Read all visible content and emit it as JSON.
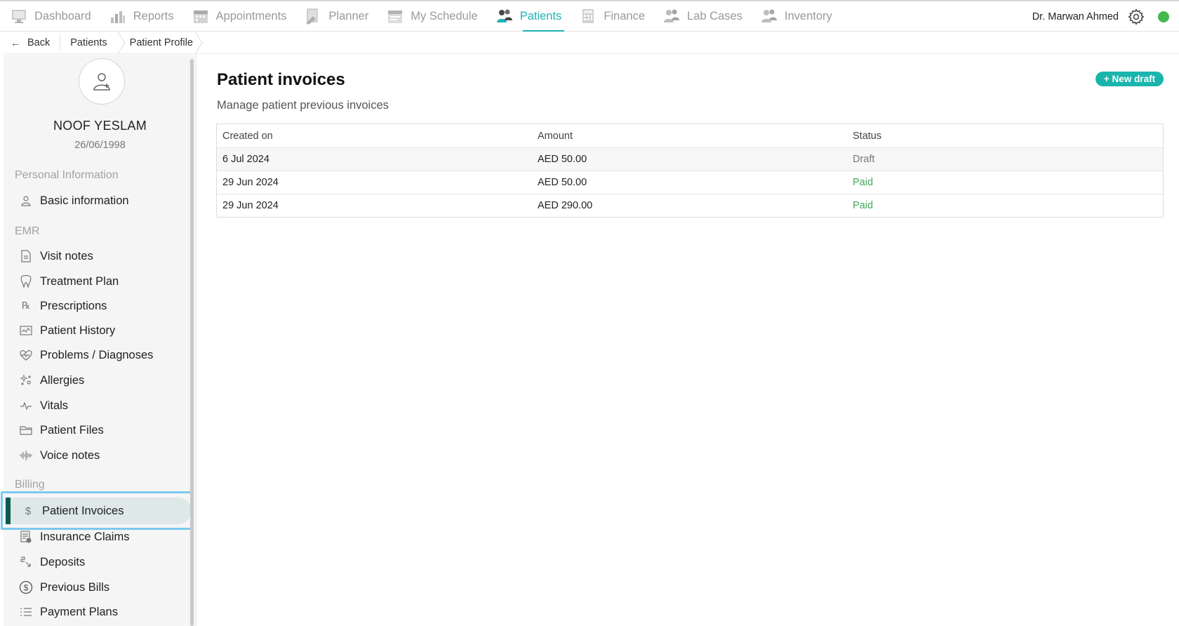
{
  "nav": {
    "items": [
      {
        "label": "Dashboard",
        "icon": "dashboard-icon"
      },
      {
        "label": "Reports",
        "icon": "reports-icon"
      },
      {
        "label": "Appointments",
        "icon": "appointments-icon"
      },
      {
        "label": "Planner",
        "icon": "planner-icon"
      },
      {
        "label": "My Schedule",
        "icon": "schedule-icon"
      },
      {
        "label": "Patients",
        "icon": "patients-icon",
        "active": true
      },
      {
        "label": "Finance",
        "icon": "finance-icon"
      },
      {
        "label": "Lab Cases",
        "icon": "lab-cases-icon"
      },
      {
        "label": "Inventory",
        "icon": "inventory-icon"
      }
    ],
    "user_name": "Dr. Marwan Ahmed",
    "status_color": "#43b94f",
    "accent_color": "#1fb3b5"
  },
  "breadcrumb": {
    "back": "Back",
    "items": [
      "Patients",
      "Patient Profile"
    ]
  },
  "patient": {
    "name": "NOOF YESLAM",
    "dob": "26/06/1998"
  },
  "sidebar": {
    "sections": [
      {
        "title": "Personal Information",
        "items": [
          {
            "label": "Basic information",
            "icon": "user-icon"
          }
        ]
      },
      {
        "title": "EMR",
        "items": [
          {
            "label": "Visit notes",
            "icon": "document-icon"
          },
          {
            "label": "Treatment Plan",
            "icon": "tooth-icon"
          },
          {
            "label": "Prescriptions",
            "icon": "prescription-icon"
          },
          {
            "label": "Patient History",
            "icon": "history-chart-icon"
          },
          {
            "label": "Problems / Diagnoses",
            "icon": "diagnosis-icon"
          },
          {
            "label": "Allergies",
            "icon": "allergy-icon"
          },
          {
            "label": "Vitals",
            "icon": "pulse-icon"
          },
          {
            "label": "Patient Files",
            "icon": "folder-icon"
          },
          {
            "label": "Voice notes",
            "icon": "waveform-icon"
          }
        ]
      },
      {
        "title": "Billing",
        "items": [
          {
            "label": "Patient Invoices",
            "icon": "dollar-icon",
            "active": true
          },
          {
            "label": "Insurance Claims",
            "icon": "claim-icon"
          },
          {
            "label": "Deposits",
            "icon": "deposit-icon"
          },
          {
            "label": "Previous Bills",
            "icon": "dollar-circle-icon"
          },
          {
            "label": "Payment Plans",
            "icon": "list-icon"
          }
        ]
      }
    ]
  },
  "main": {
    "title": "Patient invoices",
    "subtitle": "Manage patient previous invoices",
    "new_draft_label": "+ New draft",
    "columns": [
      "Created on",
      "Amount",
      "Status"
    ],
    "rows": [
      {
        "created": "6 Jul 2024",
        "amount": "AED 50.00",
        "status": "Draft"
      },
      {
        "created": "29 Jun 2024",
        "amount": "AED 50.00",
        "status": "Paid"
      },
      {
        "created": "29 Jun 2024",
        "amount": "AED 290.00",
        "status": "Paid"
      }
    ]
  }
}
